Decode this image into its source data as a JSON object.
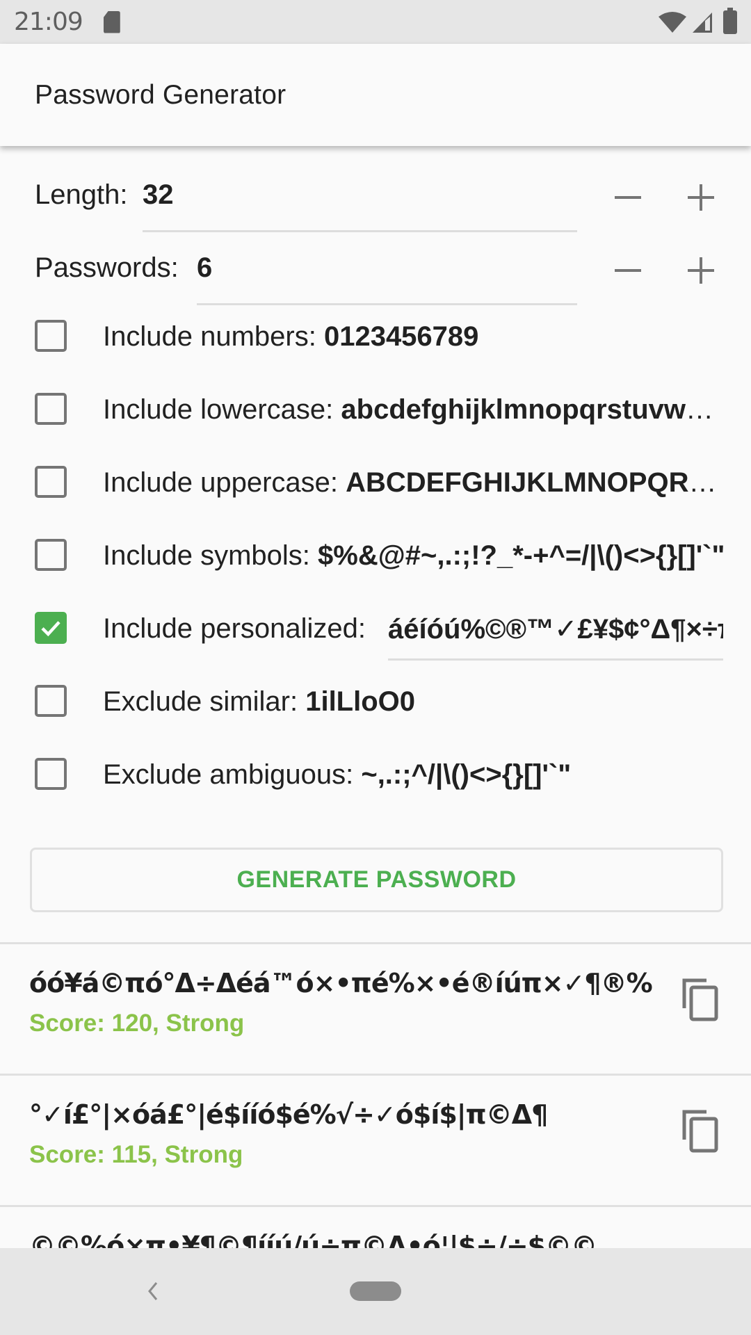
{
  "status_bar": {
    "time": "21:09",
    "icons": [
      "sd-card-icon",
      "wifi-icon",
      "signal-icon",
      "battery-icon"
    ]
  },
  "app_bar": {
    "title": "Password Generator"
  },
  "length": {
    "label": "Length:",
    "value": "32",
    "decrement_icon": "minus-icon",
    "increment_icon": "plus-icon"
  },
  "passwords": {
    "label": "Passwords:",
    "value": "6",
    "decrement_icon": "minus-icon",
    "increment_icon": "plus-icon"
  },
  "options": [
    {
      "label": "Include numbers: ",
      "value": "0123456789",
      "checked": false
    },
    {
      "label": "Include lowercase: ",
      "value": "abcdefghijklmnopqrstuvwxyz",
      "checked": false
    },
    {
      "label": "Include uppercase: ",
      "value": "ABCDEFGHIJKLMNOPQRSTUVWXYZ",
      "checked": false
    },
    {
      "label": "Include symbols: ",
      "value": "$%&@#~,.:;!?_*-+^=/|\\()<>{}[]'`\"",
      "checked": false
    },
    {
      "label": "Include personalized:",
      "value": "áéíóú%©®™✓£¥$¢°Δ¶×÷π",
      "checked": true
    },
    {
      "label": "Exclude similar: ",
      "value": "1ilLloO0",
      "checked": false
    },
    {
      "label": "Exclude ambiguous: ",
      "value": "~,.:;^/|\\()<>{}[]'`\"",
      "checked": false
    }
  ],
  "generate_button": {
    "label": "GENERATE PASSWORD"
  },
  "results": [
    {
      "password": "óó¥á©πó°Δ÷Δéá™ó×•πé%×•é®íúπ×✓¶®%",
      "score": "Score: 120, Strong"
    },
    {
      "password": "°✓í£°|×óá£°|é$ííó$é%√÷✓ó$í$|π©Δ¶",
      "score": "Score: 115, Strong"
    },
    {
      "password": "©©%ó×π•¥¶©¶ííú/ú÷π©Δ•ó¦|$÷/÷$©©",
      "score": ""
    }
  ],
  "colors": {
    "accent": "#4caf50",
    "score_strong": "#8bc34a",
    "text_primary": "#212121",
    "icon_gray": "#757575",
    "system_bar": "#e6e6e6"
  }
}
